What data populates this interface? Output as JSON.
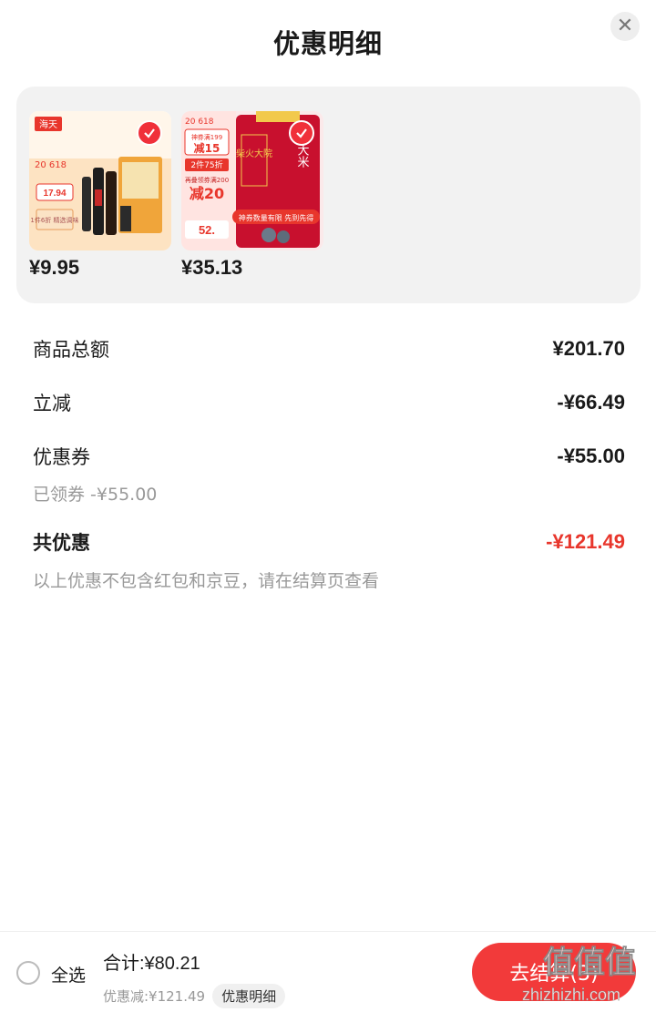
{
  "header": {
    "title": "优惠明细",
    "close_icon": "close-icon"
  },
  "products": [
    {
      "price": "¥9.95",
      "selected": true,
      "image_text": {
        "brand": "海天",
        "badge": "20 618",
        "price_tag": "17.94",
        "promo": "1件6折 精选调味"
      }
    },
    {
      "price": "¥35.13",
      "selected": true,
      "image_text": {
        "top_badge": "20 618",
        "coupon1": "神券满199",
        "coupon1_amount": "减15",
        "offer": "2件75折",
        "coupon2": "再叠领券满200",
        "coupon2_amount": "减20",
        "unit_price": "52.",
        "product_name": "柴火大院",
        "product_sub": "五常大米",
        "banner": "神券数量有限 先到先得"
      }
    }
  ],
  "summary": {
    "goods_total": {
      "label": "商品总额",
      "value": "¥201.70"
    },
    "instant_off": {
      "label": "立减",
      "value": "-¥66.49"
    },
    "coupon": {
      "label": "优惠券",
      "value": "-¥55.00",
      "sub": "已领券 -¥55.00"
    },
    "total_discount": {
      "label": "共优惠",
      "value": "-¥121.49"
    },
    "note": "以上优惠不包含红包和京豆，请在结算页查看"
  },
  "bottom_bar": {
    "select_all": "全选",
    "sum_label": "合计:¥80.21",
    "discount_line": "优惠减:¥121.49",
    "detail_chip": "优惠明细",
    "checkout": "去结算(3)"
  },
  "watermark": {
    "main": "值值值",
    "url": "zhizhizhi.com"
  },
  "colors": {
    "accent_red": "#e8362c",
    "button_red": "#f23a3a",
    "panel_gray": "#f2f2f2",
    "muted_text": "#999999"
  }
}
